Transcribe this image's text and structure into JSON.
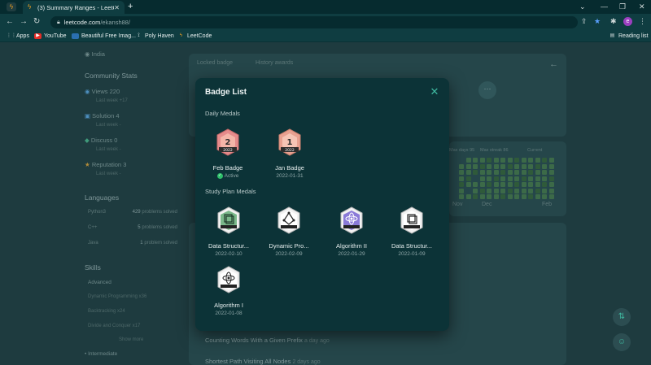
{
  "browser": {
    "tab_title": "(3) Summary Ranges - LeetCode",
    "url_host": "leetcode.com",
    "url_path": "/ekansh88/",
    "bookmarks": [
      "Apps",
      "YouTube",
      "Beautiful Free Imag...",
      "Poly Haven",
      "LeetCode"
    ],
    "reading_list": "Reading list"
  },
  "page": {
    "location": "India",
    "community_title": "Community Stats",
    "stats": [
      {
        "label": "Views",
        "value": "220",
        "sub": "Last week +17"
      },
      {
        "label": "Solution",
        "value": "4",
        "sub": "Last week -"
      },
      {
        "label": "Discuss",
        "value": "0",
        "sub": "Last week -"
      },
      {
        "label": "Reputation",
        "value": "3",
        "sub": "Last week -"
      }
    ],
    "languages_title": "Languages",
    "languages": [
      {
        "name": "Python3",
        "count": "429",
        "unit": "problems solved"
      },
      {
        "name": "C++",
        "count": "5",
        "unit": "problems solved"
      },
      {
        "name": "Java",
        "count": "1",
        "unit": "problem solved"
      }
    ],
    "skills_title": "Skills",
    "skills_advanced": "Advanced",
    "skills": [
      "Dynamic Programming x36",
      "Backtracking x24",
      "Divide and Conquer x17"
    ],
    "show_more": "Show more",
    "intermediate": "Intermediate",
    "locked_badge": "Locked badge",
    "history_awards": "History awards",
    "max_days": "Max days 95",
    "max_streak": "Max streak 86",
    "current": "Current",
    "months": [
      "Nov",
      "Dec",
      "Feb"
    ],
    "recent": [
      {
        "title": "Counting Words With a Given Prefix",
        "time": "a day ago"
      },
      {
        "title": "Shortest Path Visiting All Nodes",
        "time": "2 days ago"
      }
    ]
  },
  "modal": {
    "title": "Badge List",
    "daily_section": "Daily Medals",
    "study_section": "Study Plan Medals",
    "daily": [
      {
        "name": "Feb Badge",
        "status": "Active",
        "num": "2",
        "year": "2022",
        "color": "#e58b8b"
      },
      {
        "name": "Jan Badge",
        "date": "2022-01-31",
        "num": "1",
        "year": "2022",
        "color": "#e8a090"
      }
    ],
    "study": [
      {
        "name": "Data Structur...",
        "date": "2022-02-10",
        "tag": "Data Structure",
        "color": "#7ab88a"
      },
      {
        "name": "Dynamic Pro...",
        "date": "2022-02-09",
        "tag": "DP",
        "color": "#f2f2f2"
      },
      {
        "name": "Algorithm II",
        "date": "2022-01-29",
        "tag": "Algorithm",
        "color": "#8a7ad8"
      },
      {
        "name": "Data Structur...",
        "date": "2022-01-09",
        "tag": "Data Structure",
        "color": "#f2f2f2"
      },
      {
        "name": "Algorithm I",
        "date": "2022-01-08",
        "tag": "Algorithm",
        "color": "#f2f2f2"
      }
    ]
  }
}
